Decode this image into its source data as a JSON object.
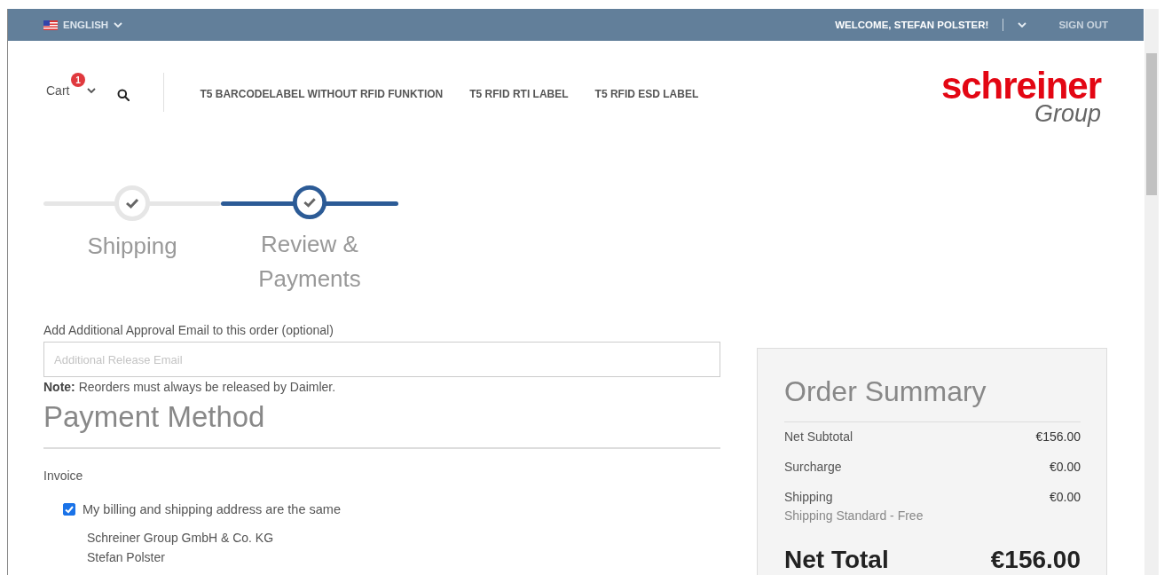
{
  "top_bar": {
    "language": "ENGLISH",
    "welcome": "WELCOME, STEFAN POLSTER!",
    "sign_out": "SIGN OUT"
  },
  "header": {
    "cart": {
      "label": "Cart",
      "badge": "1"
    },
    "nav": [
      "T5 BARCODELABEL WITHOUT RFID FUNKTION",
      "T5 RFID RTI LABEL",
      "T5 RFID ESD LABEL"
    ],
    "logo": {
      "name": "schreiner",
      "sub": "Group"
    }
  },
  "stepper": [
    {
      "label": "Shipping",
      "selected": false
    },
    {
      "label": "Review & Payments",
      "selected": true
    }
  ],
  "approval": {
    "label": "Add Additional Approval Email to this order (optional)",
    "placeholder": "Additional Release Email",
    "note": "**Note:** Reorders must always be released by Daimler."
  },
  "payment": {
    "title": "Payment Method",
    "method": "Invoice",
    "same_address": {
      "label": "My billing and shipping address are the same",
      "checked": true
    },
    "address": [
      "Schreiner Group GmbH & Co. KG",
      "Stefan Polster"
    ]
  },
  "summary": {
    "title": "Order Summary",
    "rows": [
      {
        "label": "Net Subtotal",
        "value": "€156.00"
      },
      {
        "label": "Surcharge",
        "value": "€0.00"
      },
      {
        "label": "Shipping",
        "value": "€0.00",
        "detail": "Shipping Standard - Free"
      }
    ],
    "total": {
      "label": "Net Total",
      "value": "€156.00"
    }
  }
}
